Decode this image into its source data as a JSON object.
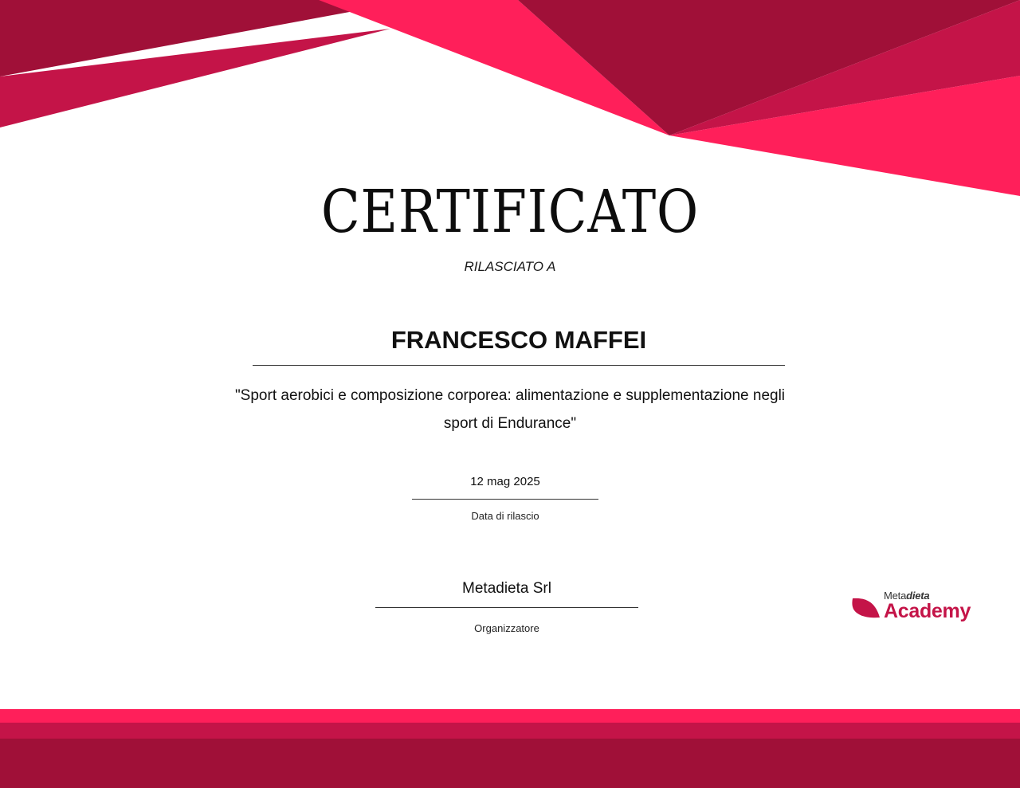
{
  "colors": {
    "dark_crimson": "#A01038",
    "crimson": "#C41448",
    "hot_pink": "#FF1F5A"
  },
  "certificate": {
    "title": "CERTIFICATO",
    "issued_to_label": "RILASCIATO A",
    "recipient_name": "FRANCESCO MAFFEI",
    "course_line_1": "\"Sport aerobici e composizione corporea: alimentazione e supplementazione negli",
    "course_line_2": "sport di Endurance\"",
    "issue_date": "12 mag 2025",
    "issue_date_label": "Data di rilascio",
    "organizer": "Metadieta Srl",
    "organizer_label": "Organizzatore"
  },
  "logo": {
    "icon": "leaf-icon",
    "small_prefix": "Meta",
    "small_suffix": "dieta",
    "big_text": "Academy"
  }
}
